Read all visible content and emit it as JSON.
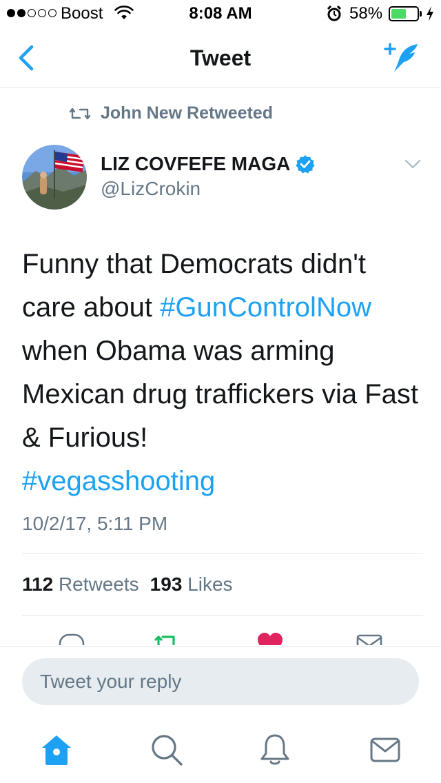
{
  "status_bar": {
    "carrier": "Boost",
    "time": "8:08 AM",
    "battery": "58%",
    "battery_level": 0.58,
    "signal_bars_filled": 2,
    "signal_bars_total": 5
  },
  "nav": {
    "title": "Tweet",
    "back_icon": "chevron-left-icon",
    "compose_icon": "compose-tweet-icon"
  },
  "retweet": {
    "text": "John New Retweeted",
    "icon": "retweet-icon"
  },
  "author": {
    "name": "LIZ COVFEFE MAGA",
    "handle": "@LizCrokin",
    "verified": true
  },
  "tweet": {
    "text_parts": [
      {
        "text": "Funny that Democrats didn't care about ",
        "hashtag": false
      },
      {
        "text": "#GunControlNow",
        "hashtag": true
      },
      {
        "text": " when Obama was arming Mexican drug traffickers via Fast & Furious! ",
        "hashtag": false
      },
      {
        "text": "#vegasshooting",
        "hashtag": true
      }
    ],
    "timestamp": "10/2/17, 5:11 PM"
  },
  "stats": {
    "retweets_count": "112",
    "retweets_label": "Retweets",
    "likes_count": "193",
    "likes_label": "Likes"
  },
  "reply": {
    "placeholder": "Tweet your reply"
  },
  "tabs": [
    {
      "name": "home",
      "icon": "home-icon",
      "active": true
    },
    {
      "name": "search",
      "icon": "search-icon",
      "active": false
    },
    {
      "name": "notifications",
      "icon": "bell-icon",
      "active": false
    },
    {
      "name": "messages",
      "icon": "envelope-icon",
      "active": false
    }
  ],
  "colors": {
    "accent": "#1da1f2",
    "retweet_green": "#17bf63",
    "like_red": "#e0245e",
    "secondary_text": "#657786",
    "divider": "#e1e8ed",
    "battery_green": "#4cd964"
  }
}
